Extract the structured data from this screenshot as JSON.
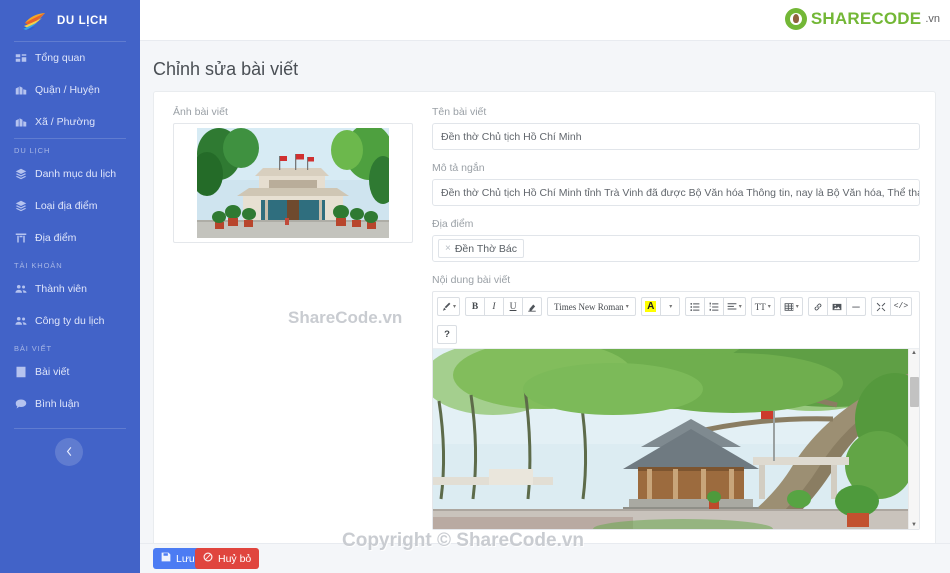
{
  "sidebar": {
    "brand": {
      "label": "DU LỊCH",
      "logo_icon": "travel-logo-icon"
    },
    "items": [
      {
        "label": "Tổng quan",
        "icon": "dashboard-icon",
        "name": "sidebar-item-tong-quan"
      },
      {
        "label": "Quận / Huyện",
        "icon": "city-icon",
        "name": "sidebar-item-quan-huyen"
      },
      {
        "label": "Xã / Phường",
        "icon": "city-icon",
        "name": "sidebar-item-xa-phuong"
      }
    ],
    "section_du_lich": {
      "header": "DU LỊCH",
      "items": [
        {
          "label": "Danh mục du lịch",
          "icon": "layers-icon",
          "name": "sidebar-item-danh-muc-du-lich"
        },
        {
          "label": "Loại địa điểm",
          "icon": "layers-icon",
          "name": "sidebar-item-loai-dia-diem"
        },
        {
          "label": "Địa điểm",
          "icon": "map-marker-icon",
          "name": "sidebar-item-dia-diem"
        }
      ]
    },
    "section_tai_khoan": {
      "header": "TÀI KHOẢN",
      "items": [
        {
          "label": "Thành viên",
          "icon": "users-icon",
          "name": "sidebar-item-thanh-vien"
        },
        {
          "label": "Công ty du lịch",
          "icon": "users-icon",
          "name": "sidebar-item-cong-ty-du-lich"
        }
      ]
    },
    "section_bai_viet": {
      "header": "BÀI VIẾT",
      "items": [
        {
          "label": "Bài viết",
          "icon": "document-icon",
          "name": "sidebar-item-bai-viet"
        },
        {
          "label": "Bình luận",
          "icon": "comment-icon",
          "name": "sidebar-item-binh-luan"
        }
      ]
    },
    "collapse_icon": "chevron-left-icon"
  },
  "topbar": {
    "logo": {
      "brand_green": "SHARECODE",
      "brand_dark": "CODE",
      "suffix": ".vn",
      "mark_color": "#6cb42c"
    }
  },
  "page": {
    "title": "Chỉnh sửa bài viết"
  },
  "form": {
    "image_label": "Ảnh bài viết",
    "title_label": "Tên bài viết",
    "title_value": "Đền thờ Chủ tịch Hồ Chí Minh",
    "summary_label": "Mô tả ngắn",
    "summary_value": "Đền thờ Chủ tịch Hồ Chí Minh tỉnh Trà Vinh đã được Bộ Văn hóa Thông tin, nay là Bộ Văn hóa, Thể thao và Du",
    "place_label": "Địa điểm",
    "place_chip": "Đền Thờ Bác",
    "place_chip_remove": "×",
    "content_label": "Nội dung bài viết"
  },
  "editor": {
    "font_name": "Times New Roman",
    "buttons": [
      {
        "name": "style-brush-button",
        "label": "brush-icon"
      },
      {
        "name": "bold-button",
        "label": "B"
      },
      {
        "name": "italic-button",
        "label": "I"
      },
      {
        "name": "underline-button",
        "label": "U"
      },
      {
        "name": "remove-format-button",
        "label": "eraser-icon"
      },
      {
        "name": "font-family-dropdown",
        "label": "Times New Roman"
      },
      {
        "name": "font-color-button",
        "label": "A"
      },
      {
        "name": "unordered-list-button",
        "label": "bullet-list-icon"
      },
      {
        "name": "ordered-list-button",
        "label": "numbered-list-icon"
      },
      {
        "name": "paragraph-align-button",
        "label": "align-icon"
      },
      {
        "name": "line-height-button",
        "label": "TT"
      },
      {
        "name": "table-button",
        "label": "table-icon"
      },
      {
        "name": "link-button",
        "label": "link-icon"
      },
      {
        "name": "picture-button",
        "label": "image-icon"
      },
      {
        "name": "horizontal-rule-button",
        "label": "minus-icon"
      },
      {
        "name": "fullscreen-button",
        "label": "expand-icon"
      },
      {
        "name": "code-view-button",
        "label": "code-icon"
      },
      {
        "name": "help-button",
        "label": "?"
      }
    ]
  },
  "footer": {
    "save_label": "Lưu",
    "save_icon": "floppy-disk-icon",
    "save_color": "#4c7cf3",
    "cancel_label": "Huỷ bỏ",
    "cancel_icon": "ban-icon",
    "cancel_color": "#e0453e"
  },
  "watermarks": {
    "middle": "ShareCode.vn",
    "bottom": "Copyright © ShareCode.vn"
  }
}
